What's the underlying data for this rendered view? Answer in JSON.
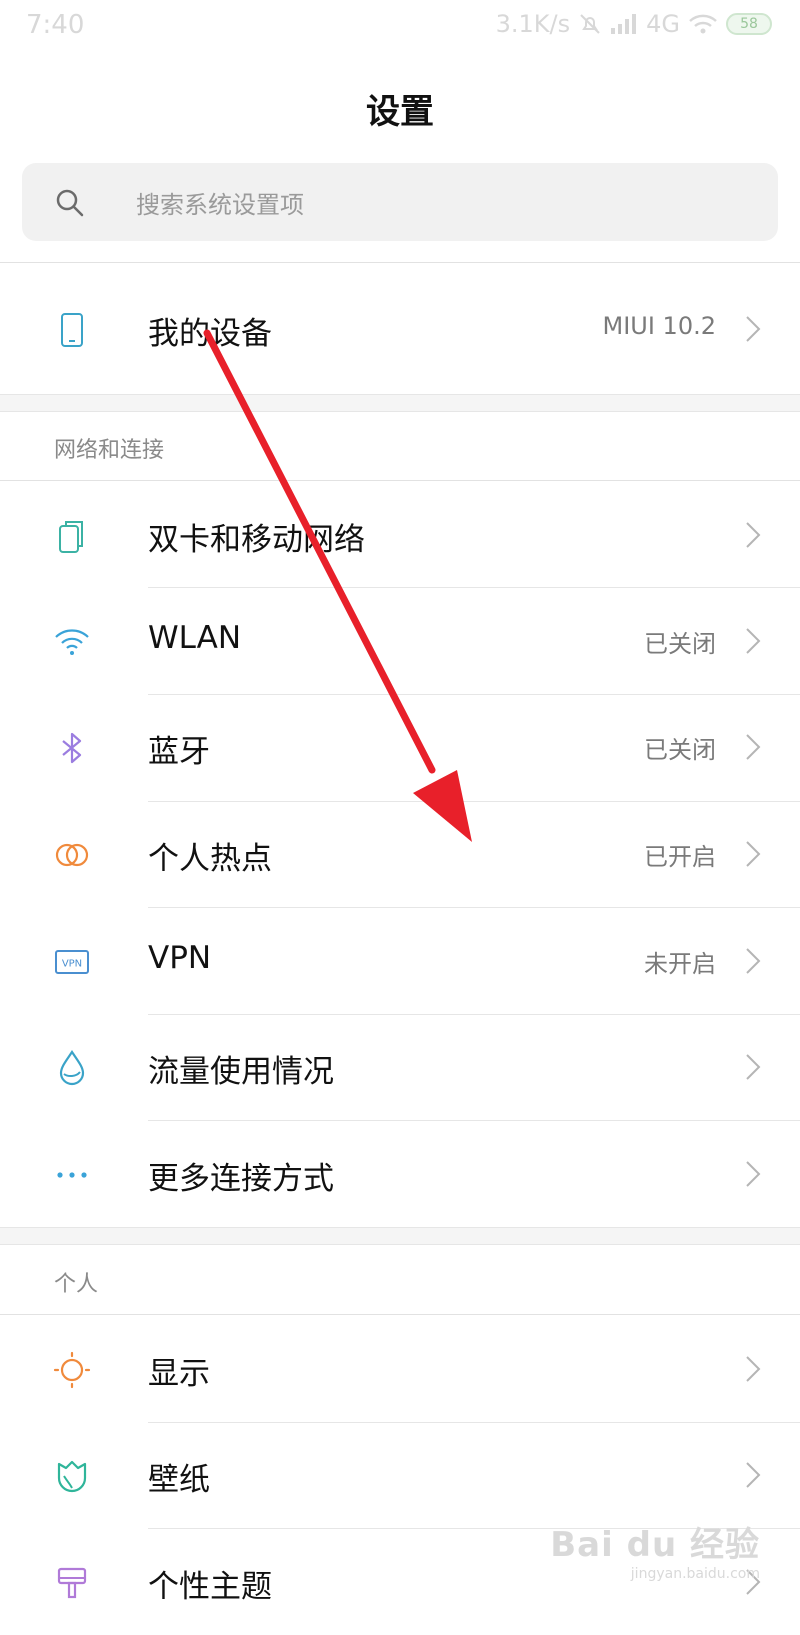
{
  "status_bar": {
    "time": "7:40",
    "network_speed": "3.1K/s",
    "network_type": "4G",
    "battery": "58"
  },
  "header": {
    "title": "设置"
  },
  "search": {
    "placeholder": "搜索系统设置项"
  },
  "device_row": {
    "label": "我的设备",
    "value": "MIUI 10.2",
    "icon": "phone-icon"
  },
  "sections": [
    {
      "title": "网络和连接",
      "items": [
        {
          "label": "双卡和移动网络",
          "value": "",
          "icon": "dual-sim-icon",
          "color": "#3bb2a4"
        },
        {
          "label": "WLAN",
          "value": "已关闭",
          "icon": "wifi-icon",
          "color": "#3aa3d8"
        },
        {
          "label": "蓝牙",
          "value": "已关闭",
          "icon": "bluetooth-icon",
          "color": "#9b7de0"
        },
        {
          "label": "个人热点",
          "value": "已开启",
          "icon": "hotspot-icon",
          "color": "#f08a3c"
        },
        {
          "label": "VPN",
          "value": "未开启",
          "icon": "vpn-icon",
          "color": "#4a8fd0"
        },
        {
          "label": "流量使用情况",
          "value": "",
          "icon": "data-usage-icon",
          "color": "#3aa3c8"
        },
        {
          "label": "更多连接方式",
          "value": "",
          "icon": "more-dots-icon",
          "color": "#3aa3d8"
        }
      ]
    },
    {
      "title": "个人",
      "items": [
        {
          "label": "显示",
          "value": "",
          "icon": "sun-icon",
          "color": "#f08a3c"
        },
        {
          "label": "壁纸",
          "value": "",
          "icon": "wallpaper-icon",
          "color": "#2fb59a"
        },
        {
          "label": "个性主题",
          "value": "",
          "icon": "theme-brush-icon",
          "color": "#b07ad8"
        }
      ]
    }
  ],
  "watermark": {
    "brand": "Bai du 经验",
    "url": "jingyan.baidu.com"
  },
  "colors": {
    "annotation_arrow": "#e8202a",
    "accent_gray": "#9a9a9a"
  }
}
